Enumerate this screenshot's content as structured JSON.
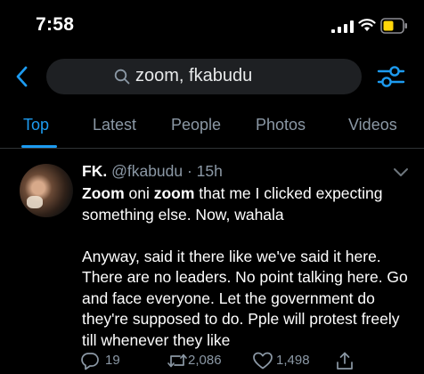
{
  "status_bar": {
    "time": "7:58"
  },
  "search": {
    "query": "zoom, fkabudu"
  },
  "tabs": [
    {
      "label": "Top",
      "active": true
    },
    {
      "label": "Latest",
      "active": false
    },
    {
      "label": "People",
      "active": false
    },
    {
      "label": "Photos",
      "active": false
    },
    {
      "label": "Videos",
      "active": false
    }
  ],
  "tweet": {
    "author_name": "FK.",
    "handle_time": "@fkabudu · 15h",
    "text_part1": "Zoom",
    "text_part2": " oni ",
    "text_part3": "zoom",
    "text_part4": " that me I clicked expecting something else. Now, wahala\n\nAnyway, said it there like we've said it here. There are no leaders. No point talking here. Go and face everyone. Let the government do they're supposed to do. Pple will protest freely till whenever they like",
    "replies": "19",
    "retweets": "2,086",
    "likes": "1,498"
  },
  "icons": {
    "back": "chevron-left-icon",
    "search": "search-icon",
    "filter": "filter-sliders-icon",
    "more": "chevron-down-icon",
    "reply": "reply-icon",
    "retweet": "retweet-icon",
    "like": "heart-icon",
    "share": "share-icon"
  },
  "colors": {
    "accent": "#1d9bf0",
    "background": "#000000",
    "muted": "#8b98a5",
    "battery": "#ffd60a"
  }
}
